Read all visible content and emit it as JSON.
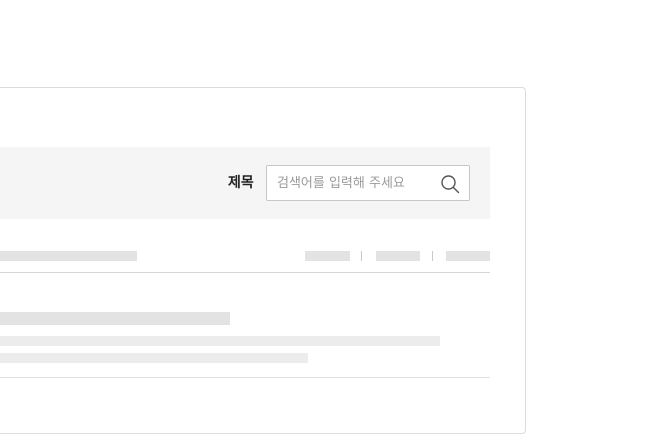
{
  "search": {
    "label": "제목",
    "placeholder": "검색어를 입력해 주세요",
    "value": ""
  },
  "icons": {
    "search": "search-icon"
  }
}
